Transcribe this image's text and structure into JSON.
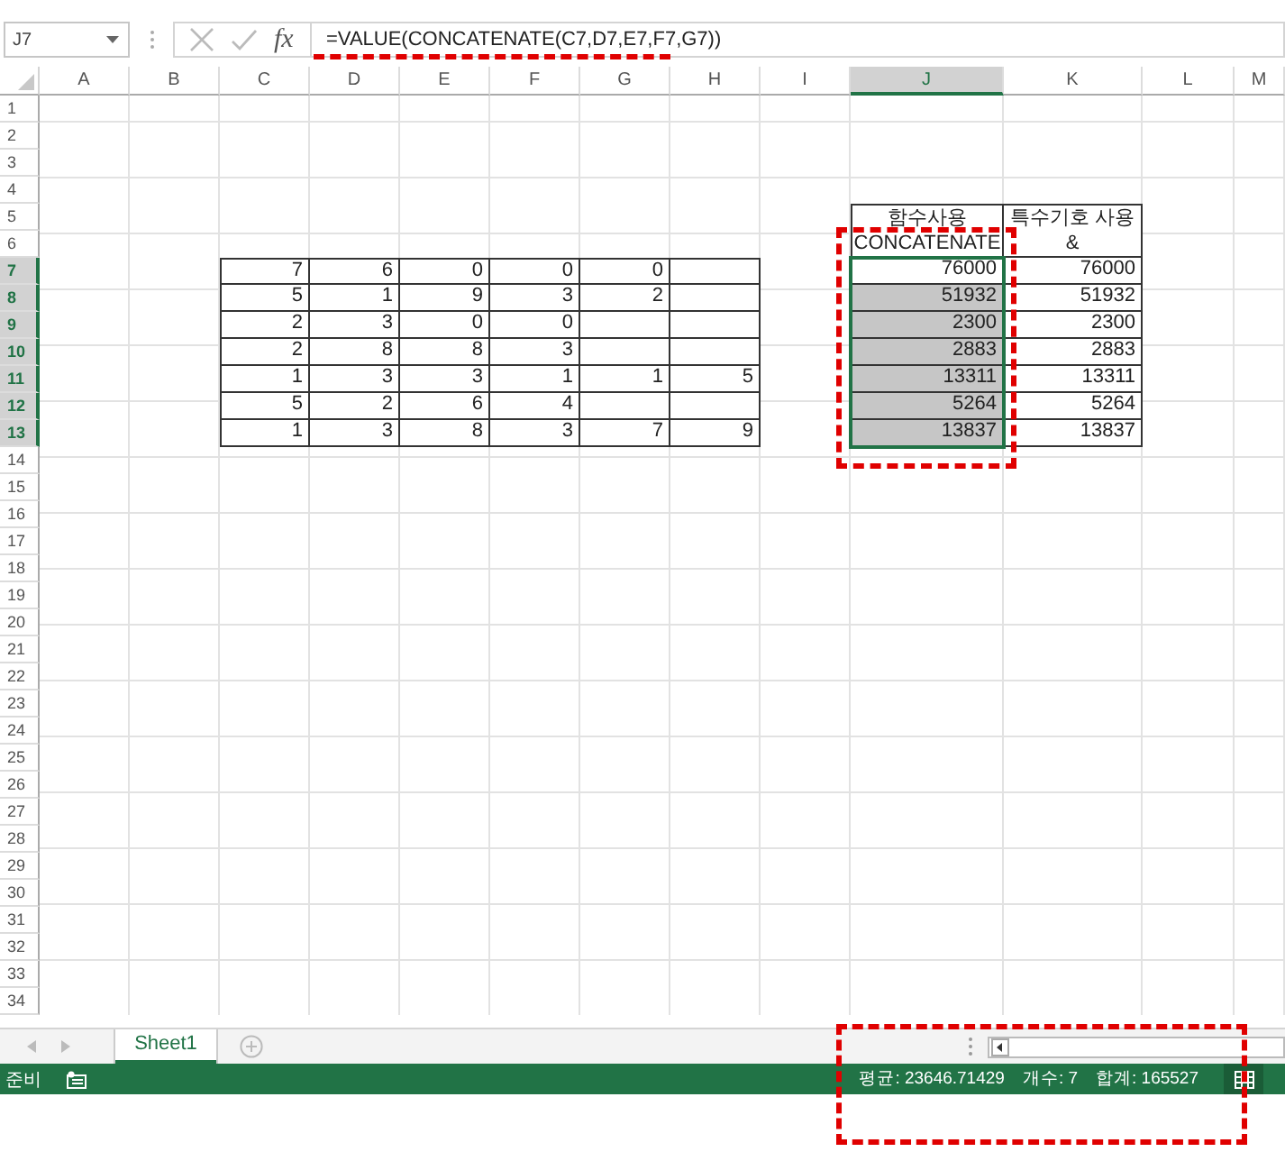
{
  "formula_bar": {
    "name_box": "J7",
    "fx_label": "fx",
    "formula": "=VALUE(CONCATENATE(C7,D7,E7,F7,G7))",
    "marked": true
  },
  "columns": [
    {
      "label": "A",
      "selected": false
    },
    {
      "label": "B",
      "selected": false
    },
    {
      "label": "C",
      "selected": false
    },
    {
      "label": "D",
      "selected": false
    },
    {
      "label": "E",
      "selected": false
    },
    {
      "label": "F",
      "selected": false
    },
    {
      "label": "G",
      "selected": false
    },
    {
      "label": "H",
      "selected": false
    },
    {
      "label": "I",
      "selected": false
    },
    {
      "label": "J",
      "selected": true
    },
    {
      "label": "K",
      "selected": false
    },
    {
      "label": "L",
      "selected": false
    },
    {
      "label": "M",
      "selected": false
    }
  ],
  "row_headers": [
    {
      "label": "1",
      "selected": false
    },
    {
      "label": "2",
      "selected": false
    },
    {
      "label": "3",
      "selected": false
    },
    {
      "label": "4",
      "selected": false
    },
    {
      "label": "5",
      "selected": false
    },
    {
      "label": "6",
      "selected": false
    },
    {
      "label": "7",
      "selected": true
    },
    {
      "label": "8",
      "selected": true
    },
    {
      "label": "9",
      "selected": true
    },
    {
      "label": "10",
      "selected": true
    },
    {
      "label": "11",
      "selected": true
    },
    {
      "label": "12",
      "selected": true
    },
    {
      "label": "13",
      "selected": true
    },
    {
      "label": "14",
      "selected": false
    },
    {
      "label": "15",
      "selected": false
    },
    {
      "label": "16",
      "selected": false
    },
    {
      "label": "17",
      "selected": false
    },
    {
      "label": "18",
      "selected": false
    },
    {
      "label": "19",
      "selected": false
    },
    {
      "label": "20",
      "selected": false
    },
    {
      "label": "21",
      "selected": false
    },
    {
      "label": "22",
      "selected": false
    },
    {
      "label": "23",
      "selected": false
    },
    {
      "label": "24",
      "selected": false
    },
    {
      "label": "25",
      "selected": false
    },
    {
      "label": "26",
      "selected": false
    },
    {
      "label": "27",
      "selected": false
    },
    {
      "label": "28",
      "selected": false
    },
    {
      "label": "29",
      "selected": false
    },
    {
      "label": "30",
      "selected": false
    },
    {
      "label": "31",
      "selected": false
    },
    {
      "label": "32",
      "selected": false
    },
    {
      "label": "33",
      "selected": false
    },
    {
      "label": "34",
      "selected": false
    }
  ],
  "digit_table": {
    "rows": [
      [
        "7",
        "6",
        "0",
        "0",
        "0"
      ],
      [
        "5",
        "1",
        "9",
        "3",
        "2"
      ],
      [
        "2",
        "3",
        "0",
        "0"
      ],
      [
        "2",
        "8",
        "8",
        "3"
      ],
      [
        "1",
        "3",
        "3",
        "1",
        "1",
        "5"
      ],
      [
        "5",
        "2",
        "6",
        "4"
      ],
      [
        "1",
        "3",
        "8",
        "3",
        "7",
        "9"
      ]
    ]
  },
  "result_table": {
    "marked": true,
    "headers": [
      {
        "lines": [
          "함수사용",
          "CONCATENATE"
        ]
      },
      {
        "lines": [
          "특수기호 사용",
          "&"
        ]
      }
    ],
    "rows": [
      {
        "function_result": "76000",
        "operator_result": "76000",
        "selected": true,
        "active": true
      },
      {
        "function_result": "51932",
        "operator_result": "51932",
        "selected": true,
        "active": false
      },
      {
        "function_result": "2300",
        "operator_result": "2300",
        "selected": true,
        "active": false
      },
      {
        "function_result": "2883",
        "operator_result": "2883",
        "selected": true,
        "active": false
      },
      {
        "function_result": "13311",
        "operator_result": "13311",
        "selected": true,
        "active": false
      },
      {
        "function_result": "5264",
        "operator_result": "5264",
        "selected": true,
        "active": false
      },
      {
        "function_result": "13837",
        "operator_result": "13837",
        "selected": true,
        "active": false
      }
    ]
  },
  "sheet_tabs": [
    {
      "label": "Sheet1",
      "selected": true
    }
  ],
  "status_bar": {
    "mode": "준비",
    "average": "평균: 23646.71429",
    "count": "개수: 7",
    "sum": "합계: 165527",
    "marked": true
  }
}
